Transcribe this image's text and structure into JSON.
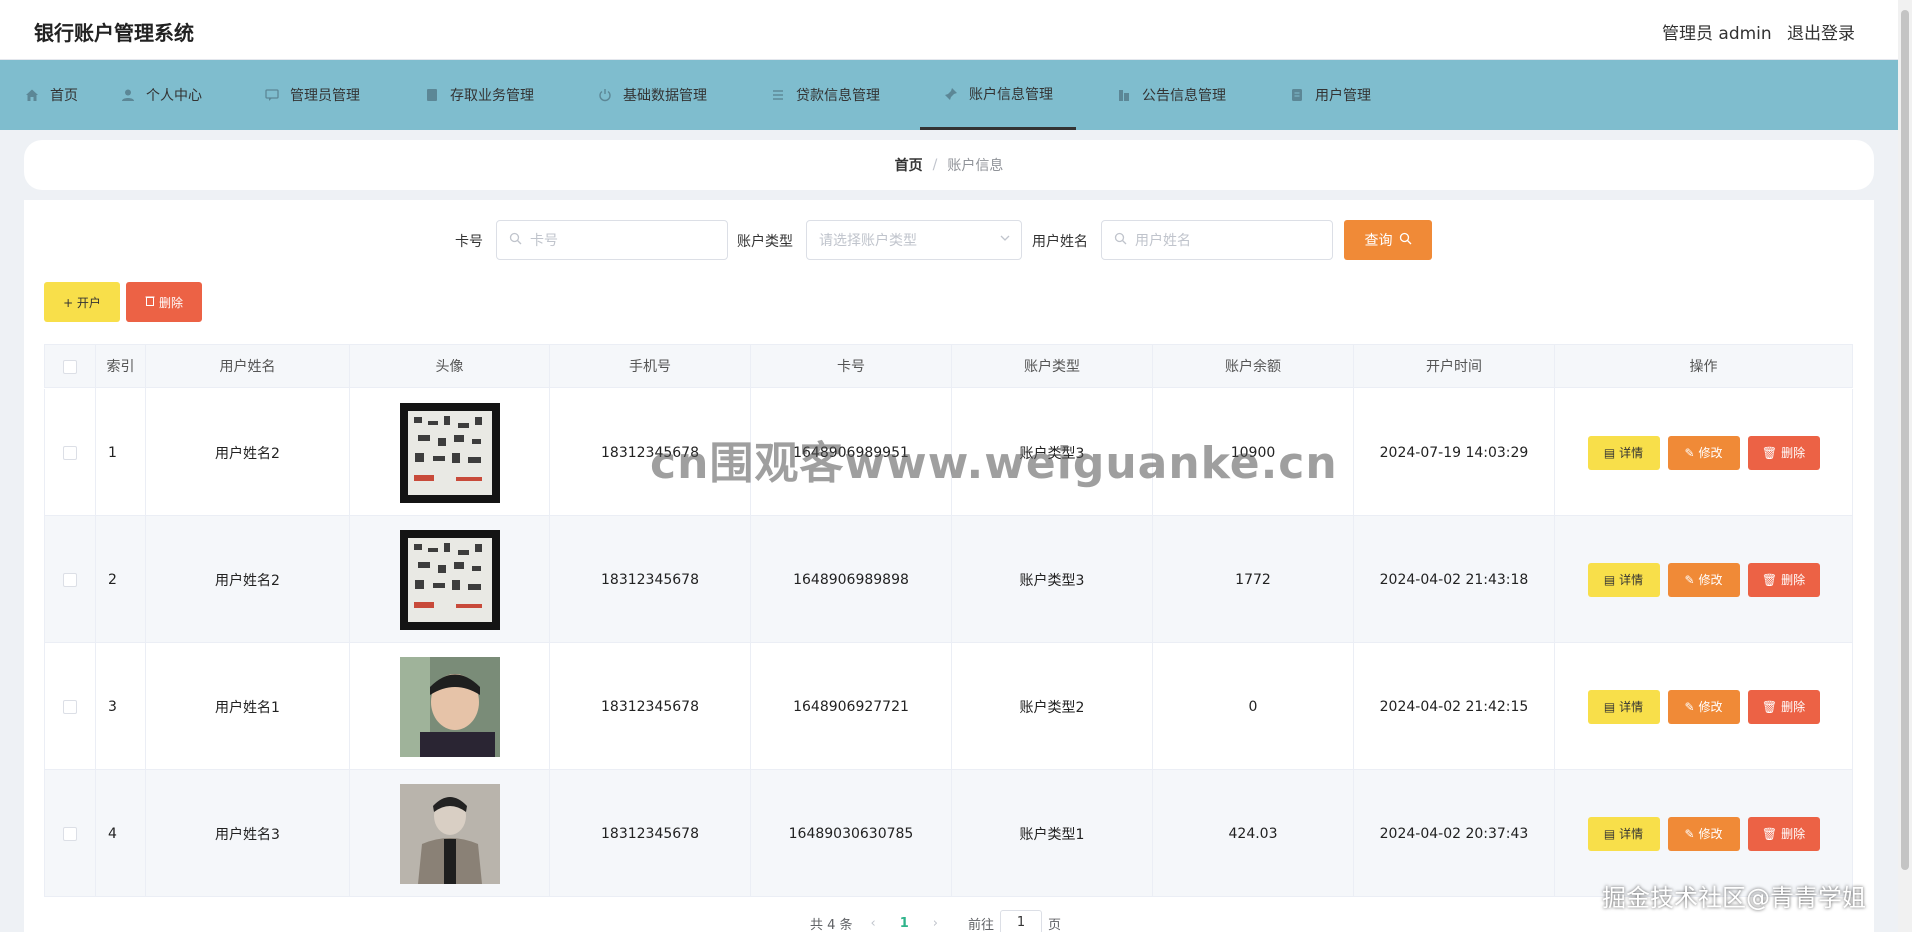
{
  "app": {
    "title": "银行账户管理系统",
    "admin_label": "管理员 admin",
    "logout": "退出登录"
  },
  "nav": {
    "items": [
      {
        "label": "首页",
        "icon": "home-icon"
      },
      {
        "label": "个人中心",
        "icon": "user-icon"
      },
      {
        "label": "管理员管理",
        "icon": "chat-icon"
      },
      {
        "label": "存取业务管理",
        "icon": "folder-icon"
      },
      {
        "label": "基础数据管理",
        "icon": "power-icon"
      },
      {
        "label": "贷款信息管理",
        "icon": "list-icon"
      },
      {
        "label": "账户信息管理",
        "icon": "pin-icon"
      },
      {
        "label": "公告信息管理",
        "icon": "building-icon"
      },
      {
        "label": "用户管理",
        "icon": "document-icon"
      }
    ],
    "active_index": 6
  },
  "breadcrumb": {
    "home": "首页",
    "separator": "/",
    "current": "账户信息"
  },
  "search": {
    "card_label": "卡号",
    "card_placeholder": "卡号",
    "type_label": "账户类型",
    "type_placeholder": "请选择账户类型",
    "name_label": "用户姓名",
    "name_placeholder": "用户姓名",
    "query_label": "查询"
  },
  "toolbar": {
    "open_label": "+ 开户",
    "delete_label": "删除"
  },
  "table": {
    "headers": [
      "索引",
      "用户姓名",
      "头像",
      "手机号",
      "卡号",
      "账户类型",
      "账户余额",
      "开户时间",
      "操作"
    ],
    "rows": [
      {
        "index": "1",
        "name": "用户姓名2",
        "phone": "18312345678",
        "card": "1648906989951",
        "type": "账户类型3",
        "balance": "10900",
        "time": "2024-07-19 14:03:29"
      },
      {
        "index": "2",
        "name": "用户姓名2",
        "phone": "18312345678",
        "card": "1648906989898",
        "type": "账户类型3",
        "balance": "1772",
        "time": "2024-04-02 21:43:18"
      },
      {
        "index": "3",
        "name": "用户姓名1",
        "phone": "18312345678",
        "card": "1648906927721",
        "type": "账户类型2",
        "balance": "0",
        "time": "2024-04-02 21:42:15"
      },
      {
        "index": "4",
        "name": "用户姓名3",
        "phone": "18312345678",
        "card": "16489030630785",
        "type": "账户类型1",
        "balance": "424.03",
        "time": "2024-04-02 20:37:43"
      }
    ],
    "actions": {
      "detail": "详情",
      "edit": "修改",
      "delete": "删除"
    }
  },
  "pagination": {
    "total_text": "共 4 条",
    "prev": "‹",
    "current_page": "1",
    "next": "›",
    "goto_label": "前往",
    "goto_value": "1",
    "page_suffix": "页"
  },
  "watermarks": {
    "center": "cn围观客www.weiguanke.cn",
    "corner": "掘金技术社区@青青学姐"
  },
  "colors": {
    "nav_bg": "#7fbdce",
    "detail": "#f8df4a",
    "edit": "#f08a37",
    "delete": "#ec6245",
    "page_active": "#2fb48b"
  }
}
